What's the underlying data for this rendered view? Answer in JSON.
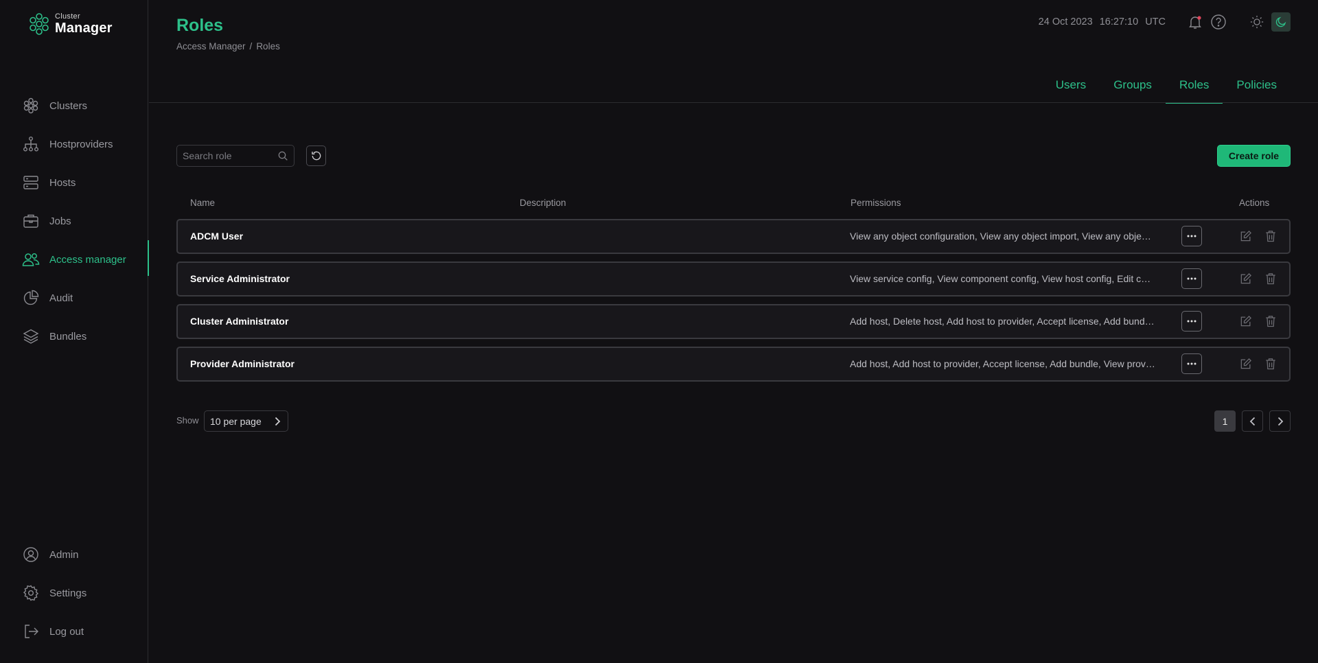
{
  "app": {
    "logo_small": "Cluster",
    "logo_big": "Manager"
  },
  "sidebar": {
    "items": [
      {
        "label": "Clusters",
        "icon": "clusters-icon"
      },
      {
        "label": "Hostproviders",
        "icon": "hierarchy-icon"
      },
      {
        "label": "Hosts",
        "icon": "server-icon"
      },
      {
        "label": "Jobs",
        "icon": "briefcase-icon"
      },
      {
        "label": "Access manager",
        "icon": "users-icon",
        "active": true
      },
      {
        "label": "Audit",
        "icon": "pie-chart-icon"
      },
      {
        "label": "Bundles",
        "icon": "layers-icon"
      }
    ],
    "bottom_items": [
      {
        "label": "Admin",
        "icon": "user-circle-icon"
      },
      {
        "label": "Settings",
        "icon": "gear-icon"
      },
      {
        "label": "Log out",
        "icon": "logout-icon"
      }
    ]
  },
  "header": {
    "title": "Roles",
    "breadcrumb": [
      "Access Manager",
      "/",
      "Roles"
    ],
    "date": "24 Oct 2023",
    "time": "16:27:10",
    "timezone": "UTC"
  },
  "tabs": [
    {
      "label": "Users"
    },
    {
      "label": "Groups"
    },
    {
      "label": "Roles",
      "active": true
    },
    {
      "label": "Policies"
    }
  ],
  "toolbar": {
    "search_placeholder": "Search role",
    "search_value": "",
    "create_label": "Create role"
  },
  "table": {
    "columns": [
      "Name",
      "Description",
      "Permissions",
      "Actions"
    ],
    "rows": [
      {
        "name": "ADCM User",
        "description": "",
        "permissions": "View any object configuration, View any object import, View any object host-components"
      },
      {
        "name": "Service Administrator",
        "description": "",
        "permissions": "View service config, View component config, View host config, Edit component config"
      },
      {
        "name": "Cluster Administrator",
        "description": "",
        "permissions": "Add host, Delete host, Add host to provider, Accept license, Add bundle, View cluster config"
      },
      {
        "name": "Provider Administrator",
        "description": "",
        "permissions": "Add host, Add host to provider, Accept license, Add bundle, View provider config"
      }
    ]
  },
  "pagination": {
    "show_label": "Show",
    "per_page": "10 per page",
    "current_page": "1"
  },
  "colors": {
    "accent": "#2dc08a",
    "background": "#111013",
    "button": "#1fb878",
    "notification_dot": "#e0445a"
  }
}
